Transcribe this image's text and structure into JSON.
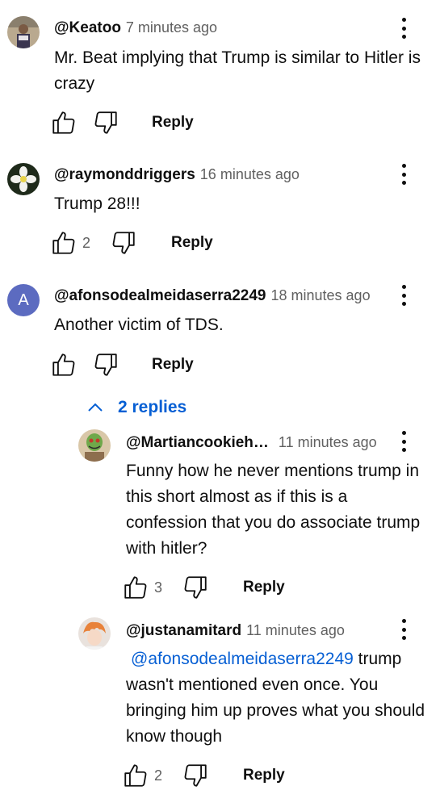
{
  "comments": [
    {
      "author": "@Keatoo",
      "time": "7 minutes ago",
      "text": "Mr. Beat implying that Trump is similar to Hitler is crazy",
      "likes": "",
      "reply_label": "Reply",
      "avatar_icon": "person-photo-avatar"
    },
    {
      "author": "@raymonddriggers",
      "time": "16 minutes ago",
      "text": "Trump 28!!!",
      "likes": "2",
      "reply_label": "Reply",
      "avatar_icon": "flower-avatar"
    },
    {
      "author": "@afonsodealmeidaserra2249",
      "time": "18 minutes ago",
      "text": "Another victim of TDS.",
      "likes": "",
      "reply_label": "Reply",
      "avatar_letter": "A",
      "avatar_color": "#5c6bc0"
    }
  ],
  "replies_toggle": {
    "label": "2 replies",
    "icon": "chevron-up-icon"
  },
  "replies": [
    {
      "author": "@Martiancookieh…",
      "time": "11 minutes ago",
      "text": "Funny how he never mentions trump in this short almost as if this is a confession that you do associate trump with hitler?",
      "likes": "3",
      "reply_label": "Reply",
      "avatar_icon": "cartoon-avatar"
    },
    {
      "author": "@justanamitard",
      "time": "11 minutes ago",
      "mention": "@afonsodealmeidaserra2249",
      "text": " trump wasn't mentioned even once. You bringing him up proves what you should know though",
      "likes": "2",
      "reply_label": "Reply",
      "avatar_icon": "anime-avatar"
    }
  ],
  "colors": {
    "link": "#065fd4",
    "secondary": "#606060",
    "text": "#0f0f0f"
  }
}
